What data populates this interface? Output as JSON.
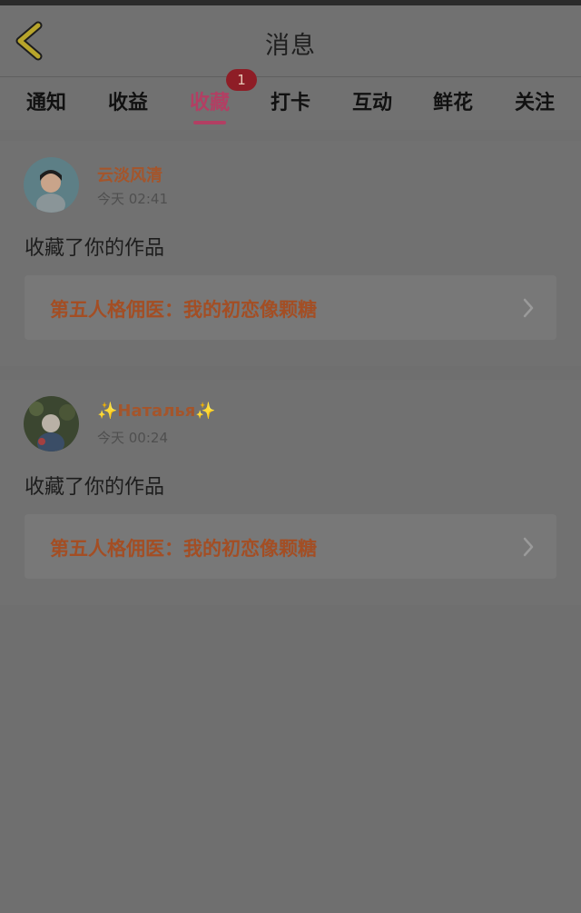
{
  "header": {
    "title": "消息"
  },
  "tabs": [
    {
      "label": "通知"
    },
    {
      "label": "收益"
    },
    {
      "label": "收藏",
      "active": true,
      "badge": "1"
    },
    {
      "label": "打卡"
    },
    {
      "label": "互动"
    },
    {
      "label": "鲜花"
    },
    {
      "label": "关注"
    }
  ],
  "messages": [
    {
      "username": "云淡风清",
      "time": "今天 02:41",
      "action": "收藏了你的作品",
      "work_title": "第五人格佣医：我的初恋像颗糖"
    },
    {
      "username": "✨Наталья✨",
      "time": "今天 00:24",
      "action": "收藏了你的作品",
      "work_title": "第五人格佣医：我的初恋像颗糖"
    }
  ],
  "colors": {
    "accent": "#b23f63",
    "username": "#a4552b",
    "badge": "#8e1d26",
    "back_arrow": "#b8a52b"
  }
}
